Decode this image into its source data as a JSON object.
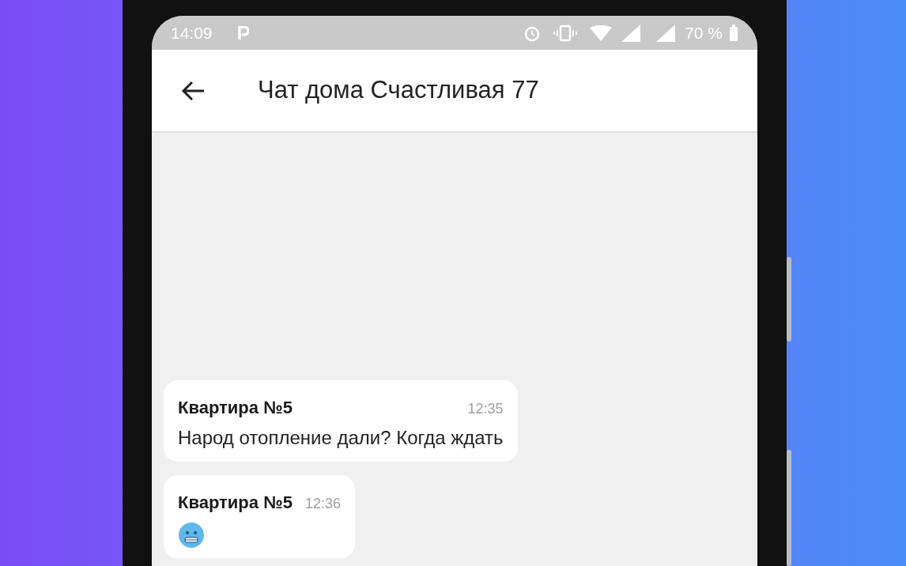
{
  "status_bar": {
    "time": "14:09",
    "battery": "70 %"
  },
  "header": {
    "title": "Чат дома Счастливая 77"
  },
  "messages": [
    {
      "kind": "text",
      "sender": "Квартира №5",
      "time": "12:35",
      "text": "Народ отопление дали? Когда ждать"
    },
    {
      "kind": "emoji",
      "sender": "Квартира №5",
      "time": "12:36"
    }
  ]
}
